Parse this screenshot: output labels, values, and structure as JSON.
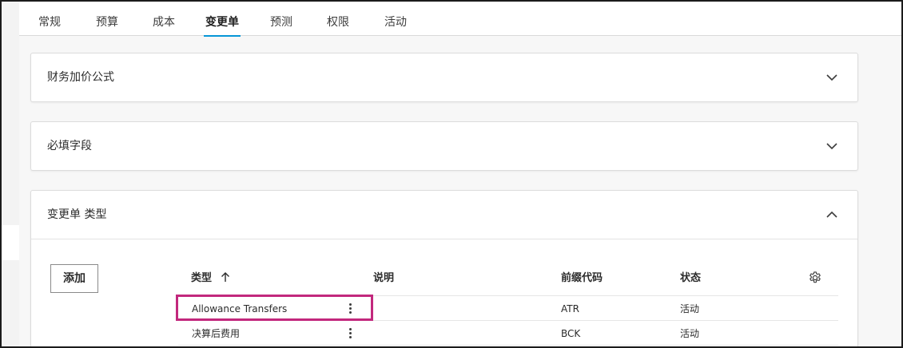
{
  "tabs": [
    {
      "label": "常规",
      "active": false
    },
    {
      "label": "预算",
      "active": false
    },
    {
      "label": "成本",
      "active": false
    },
    {
      "label": "变更单",
      "active": true
    },
    {
      "label": "预测",
      "active": false
    },
    {
      "label": "权限",
      "active": false
    },
    {
      "label": "活动",
      "active": false
    }
  ],
  "panels": {
    "markup": {
      "title": "财务加价公式",
      "expanded": false,
      "icon": "chevron-down-icon"
    },
    "required": {
      "title": "必填字段",
      "expanded": false,
      "icon": "chevron-down-icon"
    },
    "types": {
      "title": "变更单 类型",
      "expanded": true,
      "icon": "chevron-up-icon"
    }
  },
  "types_table": {
    "add_label": "添加",
    "columns": {
      "type": "类型",
      "type_sort_icon": "arrow-up-icon",
      "description": "说明",
      "prefix": "前缀代码",
      "status": "状态",
      "settings_icon": "gear-icon"
    },
    "rows": [
      {
        "type": "Allowance Transfers",
        "description": "",
        "prefix": "ATR",
        "status": "活动",
        "highlighted": true
      },
      {
        "type": "决算后费用",
        "description": "",
        "prefix": "BCK",
        "status": "活动",
        "highlighted": false
      }
    ]
  },
  "colors": {
    "accent": "#0696d7",
    "highlight": "#c2287d"
  }
}
